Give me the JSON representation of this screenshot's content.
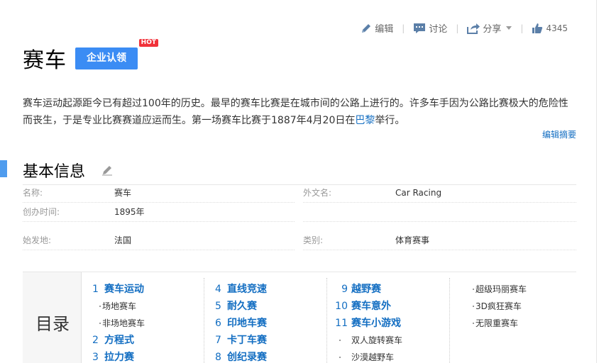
{
  "toolbar": {
    "edit_label": "编辑",
    "discuss_label": "讨论",
    "share_label": "分享",
    "like_count": "4345"
  },
  "title": {
    "text": "赛车",
    "cert_button": "企业认领",
    "hot_badge": "HOT"
  },
  "summary": {
    "text_before_link": "赛车运动起源距今已有超过100年的历史。最早的赛车比赛是在城市间的公路上进行的。许多车手因为公路比赛极大的危险性而丧生，于是专业比赛赛道应运而生。第一场赛车比赛于1887年4月20日在",
    "link_text": "巴黎",
    "text_after_link": "举行。",
    "edit_summary": "编辑摘要"
  },
  "basic_info": {
    "title": "基本信息",
    "items": [
      {
        "label": "名称:",
        "value": "赛车"
      },
      {
        "label": "外文名:",
        "value": "Car Racing"
      },
      {
        "label": "创办时间:",
        "value": "1895年"
      },
      {
        "label": "始发地:",
        "value": "法国"
      },
      {
        "label": "类别:",
        "value": "体育赛事"
      }
    ]
  },
  "catalog": {
    "title": "目录",
    "col1": [
      {
        "num": "1",
        "label": "赛车运动"
      },
      {
        "sub": "场地赛车"
      },
      {
        "sub": "非场地赛车"
      },
      {
        "num": "2",
        "label": "方程式"
      },
      {
        "num": "3",
        "label": "拉力赛"
      }
    ],
    "col2": [
      {
        "num": "4",
        "label": "直线竞速"
      },
      {
        "num": "5",
        "label": "耐久赛"
      },
      {
        "num": "6",
        "label": "印地车赛"
      },
      {
        "num": "7",
        "label": "卡丁车赛"
      },
      {
        "num": "8",
        "label": "创纪录赛"
      }
    ],
    "col3": [
      {
        "num": "9",
        "label": "越野赛"
      },
      {
        "num": "10",
        "label": "赛车意外"
      },
      {
        "num": "11",
        "label": "赛车小游戏"
      },
      {
        "sub": "双人旋转赛车"
      },
      {
        "sub": "沙漠越野车"
      }
    ],
    "col4": [
      {
        "sub": "超级玛丽赛车"
      },
      {
        "sub": "3D疯狂赛车"
      },
      {
        "sub": "无限重赛车"
      }
    ]
  },
  "colors": {
    "accent_blue": "#3b8cf4",
    "link_blue": "#136ec2",
    "hot_red": "#f1323a"
  }
}
